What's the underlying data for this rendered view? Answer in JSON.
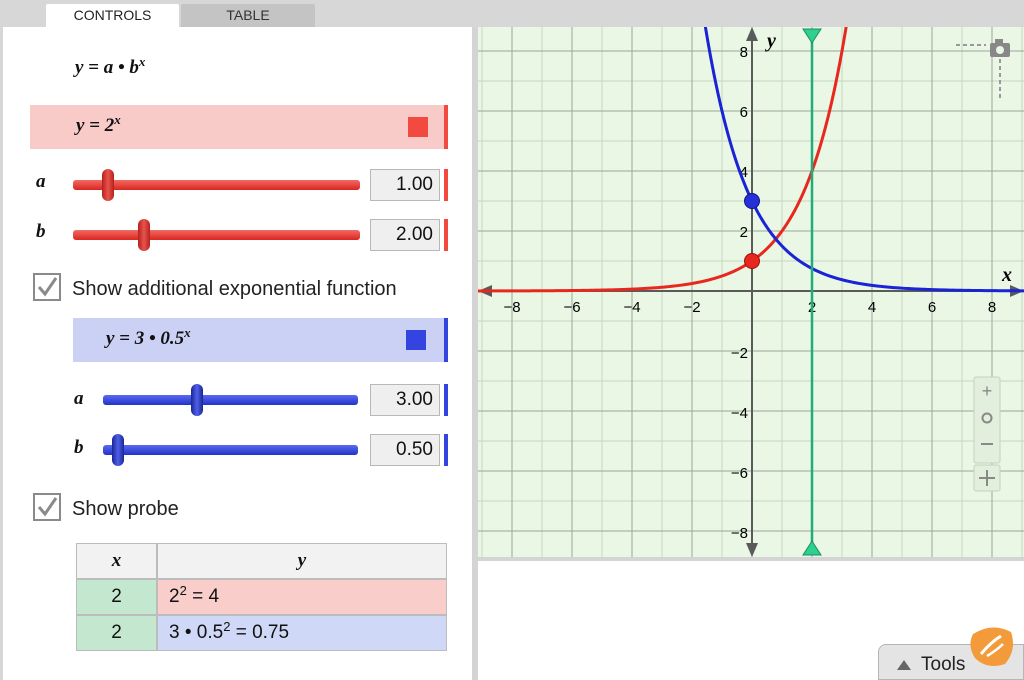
{
  "tabs": {
    "controls": "CONTROLS",
    "table": "TABLE"
  },
  "controls": {
    "general_formula": {
      "base": "y = a • b",
      "exp": "x"
    },
    "red_function": {
      "text": "y = 2",
      "exp": "x",
      "color": "#f24a3f",
      "bg": "#f8cbc8",
      "a": {
        "label": "a",
        "value": "1.00",
        "fraction": 0.1
      },
      "b": {
        "label": "b",
        "value": "2.00",
        "fraction": 0.25
      }
    },
    "show_additional": {
      "label": "Show additional exponential function",
      "checked": true
    },
    "blue_function": {
      "text": "y = 3 • 0.5",
      "exp": "x",
      "color": "#3444e0",
      "bg": "#cbd0f5",
      "a": {
        "label": "a",
        "value": "3.00",
        "fraction": 0.37
      },
      "b": {
        "label": "b",
        "value": "0.50",
        "fraction": 0.05
      }
    },
    "show_probe": {
      "label": "Show probe",
      "checked": true
    },
    "probe_table": {
      "headers": {
        "x": "x",
        "y": "y"
      },
      "rows": [
        {
          "x": "2",
          "y_base": "2",
          "y_exp": "2",
          "y_rest": " = 4",
          "bg": "#f8cdca"
        },
        {
          "x": "2",
          "y_base": "3 • 0.5",
          "y_exp": "2",
          "y_rest": " = 0.75",
          "bg": "#cfd8f6"
        }
      ]
    }
  },
  "graph": {
    "x_axis_label": "x",
    "y_axis_label": "y",
    "x_ticks": [
      "−8",
      "−6",
      "−4",
      "−2",
      "2",
      "4",
      "6",
      "8"
    ],
    "y_ticks": [
      "8",
      "6",
      "4",
      "2",
      "−2",
      "−4",
      "−6",
      "−8"
    ],
    "probe_x": 2,
    "probe_color": "#1fae7a",
    "red_y_intercept": 1,
    "blue_y_intercept": 3
  },
  "tools": {
    "label": "Tools"
  }
}
